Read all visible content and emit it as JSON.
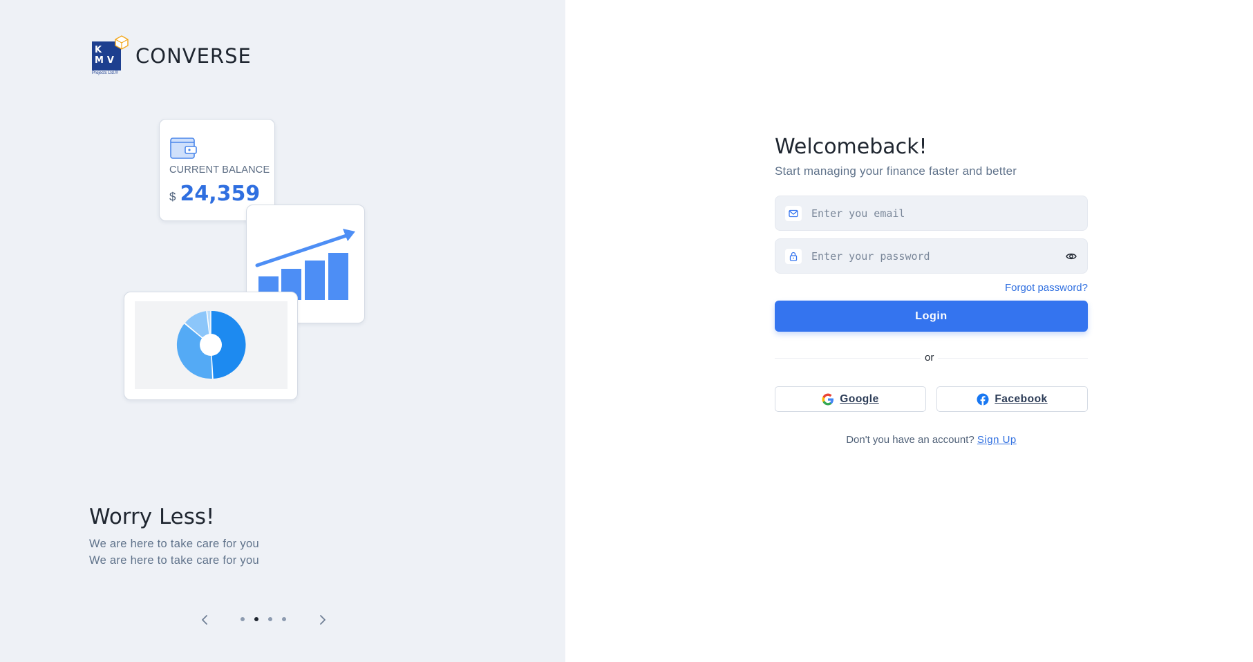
{
  "brand": {
    "name": "CONVERSE",
    "logo_letters_top": "K",
    "logo_letters_bottom": "MV",
    "logo_subtext": "Projects Ltd.®"
  },
  "illustration": {
    "balance_label": "CURRENT BALANCE",
    "currency": "$",
    "amount": "24,359"
  },
  "slide": {
    "title": "Worry Less!",
    "line1": "We are here to take care for you",
    "line2": "We are here to take care for you",
    "total_slides": 4,
    "active_index": 1
  },
  "login": {
    "title": "Welcomeback!",
    "subtitle": "Start managing your finance faster and better",
    "email_placeholder": "Enter you email",
    "password_placeholder": "Enter your password",
    "forgot_label": "Forgot password?",
    "login_label": "Login",
    "or_label": "or",
    "google_label": "Google",
    "facebook_label": "Facebook",
    "no_account_text": "Don't you have an account?",
    "signup_label": "Sign Up"
  },
  "colors": {
    "accent": "#3474ef",
    "left_bg": "#eef1f6",
    "brand_navy": "#1d3f8f"
  },
  "icons": {
    "email": "mail-icon",
    "password": "lock-icon",
    "visibility": "eye-icon",
    "prev": "chevron-left-icon",
    "next": "chevron-right-icon"
  }
}
